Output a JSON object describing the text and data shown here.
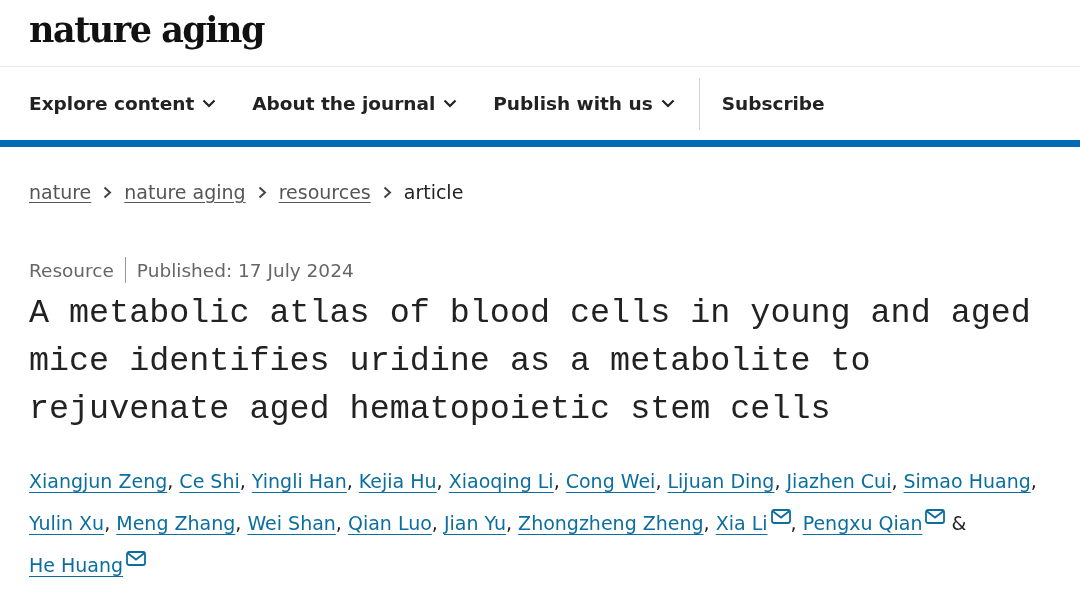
{
  "logo": "nature aging",
  "nav": [
    {
      "label": "Explore content",
      "kind": "menu"
    },
    {
      "label": "About the journal",
      "kind": "menu"
    },
    {
      "label": "Publish with us",
      "kind": "menu"
    },
    {
      "label": "Subscribe",
      "kind": "link"
    }
  ],
  "breadcrumbs": [
    {
      "label": "nature",
      "kind": "link"
    },
    {
      "label": "nature aging",
      "kind": "link"
    },
    {
      "label": "resources",
      "kind": "link"
    },
    {
      "label": "article",
      "kind": "current"
    }
  ],
  "article_type": "Resource",
  "published": "Published: 17 July 2024",
  "title": "A metabolic atlas of blood cells in young and aged mice identifies uridine as a metabolite to rejuvenate aged hematopoietic stem cells",
  "authors": [
    {
      "name": "Xiangjun Zeng",
      "corresponding": false,
      "after": ","
    },
    {
      "name": "Ce Shi",
      "corresponding": false,
      "after": ","
    },
    {
      "name": "Yingli Han",
      "corresponding": false,
      "after": ","
    },
    {
      "name": "Kejia Hu",
      "corresponding": false,
      "after": ","
    },
    {
      "name": "Xiaoqing Li",
      "corresponding": false,
      "after": ","
    },
    {
      "name": "Cong Wei",
      "corresponding": false,
      "after": ","
    },
    {
      "name": "Lijuan Ding",
      "corresponding": false,
      "after": ","
    },
    {
      "name": "Jiazhen Cui",
      "corresponding": false,
      "after": ","
    },
    {
      "name": "Simao Huang",
      "corresponding": false,
      "after": ","
    },
    {
      "name": "Yulin Xu",
      "corresponding": false,
      "after": ","
    },
    {
      "name": "Meng Zhang",
      "corresponding": false,
      "after": ","
    },
    {
      "name": "Wei Shan",
      "corresponding": false,
      "after": ","
    },
    {
      "name": "Qian Luo",
      "corresponding": false,
      "after": ","
    },
    {
      "name": "Jian Yu",
      "corresponding": false,
      "after": ","
    },
    {
      "name": "Zhongzheng Zheng",
      "corresponding": false,
      "after": ","
    },
    {
      "name": "Xia Li",
      "corresponding": true,
      "after": ","
    },
    {
      "name": "Pengxu Qian",
      "corresponding": true,
      "after": "&"
    },
    {
      "name": "He Huang",
      "corresponding": true
    }
  ]
}
